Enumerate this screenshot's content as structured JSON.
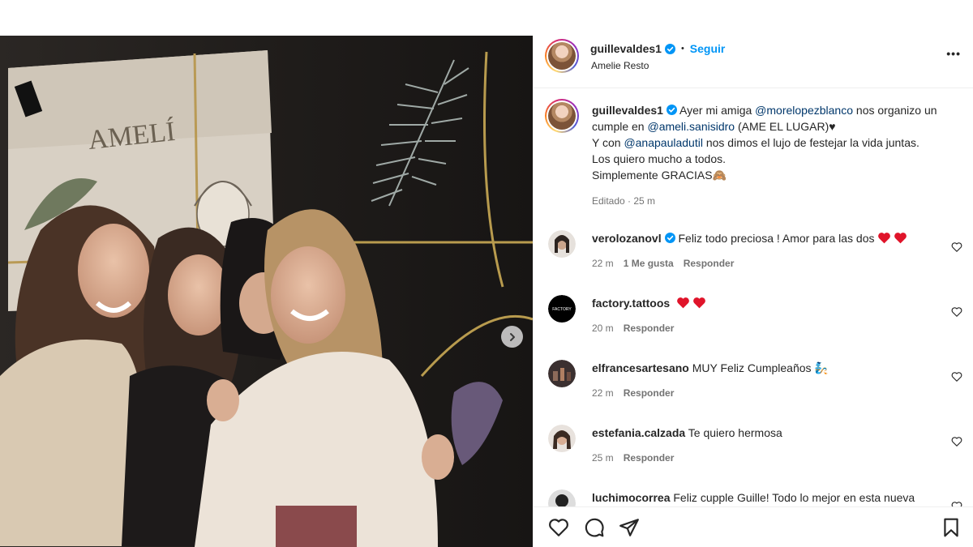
{
  "post": {
    "author": "guillevaldes1",
    "follow_label": "Seguir",
    "location": "Amelie Resto",
    "more_label": "•••",
    "sign_text": "AMELÍ"
  },
  "caption": {
    "username": "guillevaldes1",
    "t1": " Ayer mi amiga ",
    "m1": "@morelopezblanco",
    "t2": " nos organizo un cumple en ",
    "m2": "@ameli.sanisidro",
    "t3": " (AME EL LUGAR)♥",
    "t4": "Y con ",
    "m3": "@anapauladutil",
    "t5": " nos dimos el lujo de festejar la vida juntas.",
    "line3": "Los quiero mucho a todos.",
    "line4": "Simplemente GRACIAS🙈",
    "edited": "Editado · 25 m"
  },
  "comments": [
    {
      "username": "verolozanovl",
      "text": " Feliz todo preciosa ! Amor para las dos",
      "time": "22 m",
      "likes": "1 Me gusta",
      "reply": "Responder"
    },
    {
      "username": "factory.tattoos",
      "text": "",
      "time": "20 m",
      "likes": "",
      "reply": "Responder",
      "avatar_text": "FACTORY"
    },
    {
      "username": "elfrancesartesano",
      "text": " MUY Feliz Cumpleaños 🧞",
      "time": "22 m",
      "likes": "",
      "reply": "Responder"
    },
    {
      "username": "estefania.calzada",
      "text": " Te quiero hermosa",
      "time": "25 m",
      "likes": "",
      "reply": "Responder"
    },
    {
      "username": "luchimocorrea",
      "text": " Feliz cupple Guille! Todo lo mejor en esta nueva",
      "time": "",
      "likes": "",
      "reply": ""
    }
  ],
  "icons": {
    "like": "heart-icon",
    "comment": "comment-icon",
    "share": "share-icon",
    "save": "bookmark-icon",
    "verified": "verified-badge-icon",
    "next": "chevron-right-icon"
  },
  "colors": {
    "accent": "#0095f6",
    "mention": "#00376b",
    "heart_emoji": "#e0142a",
    "meta": "#737373"
  }
}
